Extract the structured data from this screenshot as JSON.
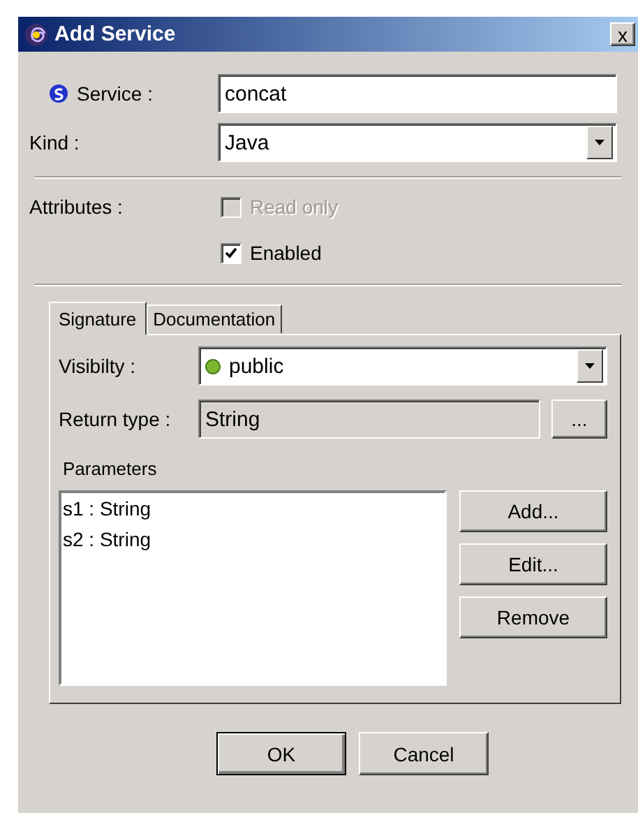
{
  "window": {
    "title": "Add Service",
    "close": "x"
  },
  "service": {
    "label": "Service :",
    "value": "concat"
  },
  "kind": {
    "label": "Kind :",
    "value": "Java"
  },
  "attributes": {
    "label": "Attributes :",
    "options": [
      {
        "label": "Read only",
        "checked": false,
        "disabled": true
      },
      {
        "label": "Enabled",
        "checked": true,
        "disabled": false
      }
    ]
  },
  "tabs": [
    {
      "label": "Signature",
      "selected": true
    },
    {
      "label": "Documentation",
      "selected": false
    }
  ],
  "visibility": {
    "label": "Visibilty :",
    "value": "public"
  },
  "return_type": {
    "label": "Return type :",
    "value": "String",
    "browse": "..."
  },
  "parameters": {
    "label": "Parameters",
    "items": [
      "s1 : String",
      "s2 : String"
    ],
    "buttons": [
      "Add...",
      "Edit...",
      "Remove"
    ]
  },
  "buttons": [
    "OK",
    "Cancel"
  ]
}
